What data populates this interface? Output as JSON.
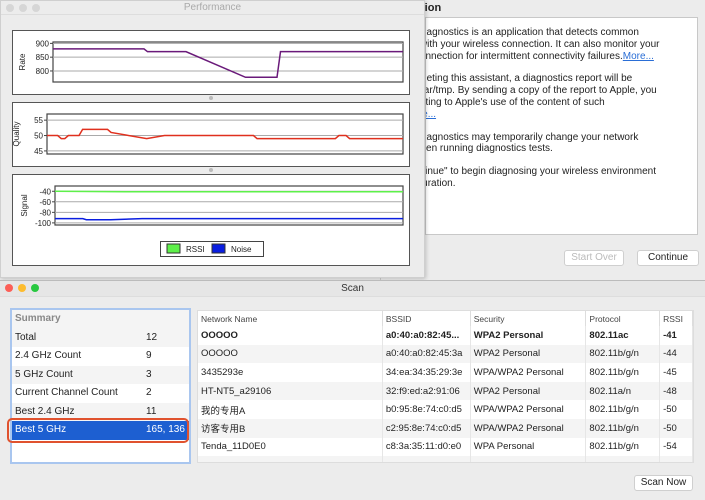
{
  "assistant": {
    "title_fragment": "tion",
    "paragraphs": [
      {
        "lines": [
          "Wireless Diagnostics is an application that detects common",
          "problems with your wireless connection. It can also monitor your",
          "wireless connection for intermittent connectivity failures."
        ],
        "link": "More..."
      },
      {
        "lines": [
          "After completing this assistant, a diagnostics report will be",
          "saved in /var/tmp. By sending a copy of the report to Apple, you",
          "are consenting to Apple's use of the content of such",
          "report."
        ],
        "link": "More..."
      },
      {
        "lines": [
          "Wireless Diagnostics may temporarily change your network",
          "settings when running diagnostics tests."
        ],
        "link": ""
      },
      {
        "lines": [
          "Click \"Continue\" to begin diagnosing your wireless environment",
          "and configuration."
        ],
        "link": ""
      }
    ],
    "start_over": "Start Over",
    "continue": "Continue"
  },
  "performance": {
    "title": "Performance",
    "chart_data": [
      {
        "type": "line",
        "ylabel": "Rate",
        "yticks": [
          900,
          850,
          800
        ],
        "ylim": [
          760,
          905
        ],
        "grid": true,
        "series": [
          {
            "color": "#6a1a7a",
            "points": [
              [
                0,
                880
              ],
              [
                26,
                880
              ],
              [
                27,
                870
              ],
              [
                38,
                870
              ],
              [
                55,
                777
              ],
              [
                64,
                777
              ],
              [
                65,
                870
              ],
              [
                100,
                870
              ]
            ]
          }
        ]
      },
      {
        "type": "line",
        "ylabel": "Quality",
        "yticks": [
          55,
          50,
          45
        ],
        "ylim": [
          44,
          57
        ],
        "grid": true,
        "series": [
          {
            "color": "#e0301e",
            "points": [
              [
                0,
                50
              ],
              [
                3,
                50
              ],
              [
                4,
                49
              ],
              [
                5,
                49
              ],
              [
                6,
                50
              ],
              [
                9,
                50
              ],
              [
                10,
                52
              ],
              [
                17,
                52
              ],
              [
                18,
                51
              ],
              [
                28,
                49
              ],
              [
                33,
                50
              ],
              [
                58,
                50
              ],
              [
                59,
                49
              ],
              [
                81,
                49
              ],
              [
                82,
                50
              ],
              [
                84,
                50
              ],
              [
                85,
                49
              ],
              [
                100,
                49
              ]
            ]
          }
        ]
      },
      {
        "type": "line",
        "ylabel": "Signal",
        "yticks": [
          -40,
          -60,
          -80,
          -100
        ],
        "ylim": [
          -104,
          -30
        ],
        "grid": true,
        "legend": "bottom",
        "series": [
          {
            "name": "RSSI",
            "color": "#5ef04a",
            "points": [
              [
                0,
                -40
              ],
              [
                20,
                -41
              ],
              [
                50,
                -41
              ],
              [
                100,
                -41
              ]
            ]
          },
          {
            "name": "Noise",
            "color": "#0a1ee0",
            "points": [
              [
                0,
                -92
              ],
              [
                8,
                -92
              ],
              [
                9,
                -94
              ],
              [
                16,
                -94
              ],
              [
                25,
                -92
              ],
              [
                100,
                -92
              ]
            ]
          }
        ]
      }
    ]
  },
  "scan": {
    "title": "Scan",
    "summary": {
      "header": "Summary",
      "rows": [
        [
          "Total",
          "12"
        ],
        [
          "2.4 GHz Count",
          "9"
        ],
        [
          "5 GHz Count",
          "3"
        ],
        [
          "Current Channel Count",
          "2"
        ],
        [
          "Best 2.4 GHz",
          "11"
        ],
        [
          "Best 5 GHz",
          "165, 136"
        ]
      ],
      "selected": 5
    },
    "columns": [
      "Network Name",
      "BSSID",
      "Security",
      "Protocol",
      "RSSI"
    ],
    "rows": [
      [
        "OOOOO",
        "a0:40:a0:82:45...",
        "WPA2 Personal",
        "802.11ac",
        "-41"
      ],
      [
        "OOOOO",
        "a0:40:a0:82:45:3a",
        "WPA2 Personal",
        "802.11b/g/n",
        "-44"
      ],
      [
        "3435293e",
        "34:ea:34:35:29:3e",
        "WPA/WPA2 Personal",
        "802.11b/g/n",
        "-45"
      ],
      [
        "HT-NT5_a29106",
        "32:f9:ed:a2:91:06",
        "WPA2 Personal",
        "802.11a/n",
        "-48"
      ],
      [
        "我的专用A",
        "b0:95:8e:74:c0:d5",
        "WPA/WPA2 Personal",
        "802.11b/g/n",
        "-50"
      ],
      [
        "访客专用B",
        "c2:95:8e:74:c0:d5",
        "WPA/WPA2 Personal",
        "802.11b/g/n",
        "-50"
      ],
      [
        "Tenda_11D0E0",
        "c8:3a:35:11:d0:e0",
        "WPA Personal",
        "802.11b/g/n",
        "-54"
      ]
    ],
    "scan_now": "Scan Now"
  }
}
